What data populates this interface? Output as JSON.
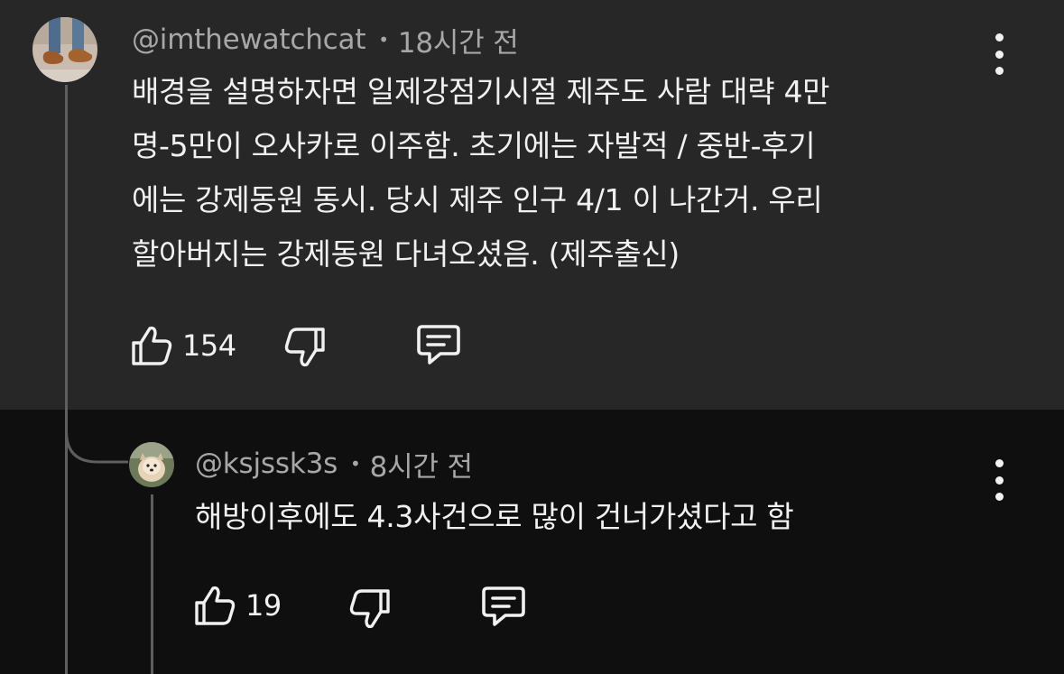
{
  "comment": {
    "handle": "@imthewatchcat",
    "separator": "•",
    "time": "18시간 전",
    "lines": [
      "배경을 설명하자면 일제강점기시절 제주도 사람 대략 4만",
      "명-5만이 오사카로 이주함. 초기에는 자발적 / 중반-후기",
      "에는 강제동원 동시. 당시 제주 인구 4/1 이 나간거. 우리",
      "할아버지는 강제동원 다녀오셨음. (제주출신)"
    ],
    "like_count": "154",
    "avatar_icon": "avatar-shoes-photo",
    "colors": {
      "background": "#272727",
      "text": "#f1f1f1",
      "meta": "#a7a7a7"
    }
  },
  "reply": {
    "handle": "@ksjssk3s",
    "separator": "•",
    "time": "8시간 전",
    "lines": [
      "해방이후에도 4.3사건으로 많이 건너가셨다고 함"
    ],
    "like_count": "19",
    "avatar_icon": "avatar-dog-photo",
    "colors": {
      "background": "#0f0f0f",
      "text": "#f1f1f1",
      "meta": "#a7a7a7"
    }
  },
  "icons": {
    "like": "thumbs-up-icon",
    "dislike": "thumbs-down-icon",
    "reply": "reply-comment-icon",
    "more": "more-vertical-icon"
  }
}
